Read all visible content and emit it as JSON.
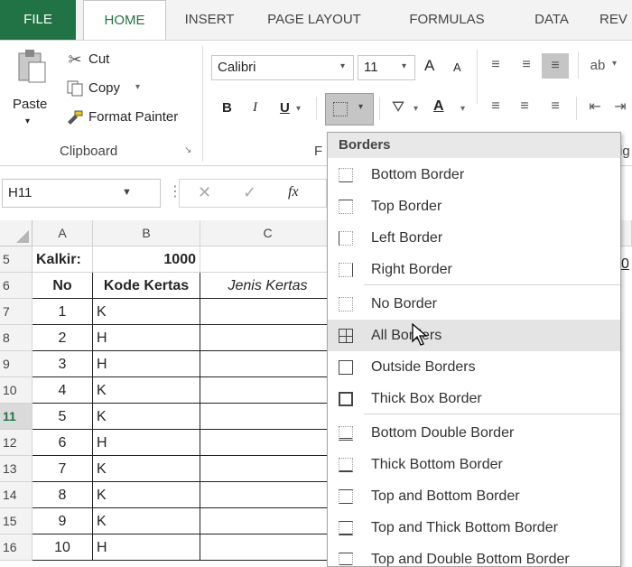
{
  "tabs": [
    {
      "label": "FILE"
    },
    {
      "label": "HOME"
    },
    {
      "label": "INSERT"
    },
    {
      "label": "PAGE LAYOUT"
    },
    {
      "label": "FORMULAS"
    },
    {
      "label": "DATA"
    },
    {
      "label": "REV"
    }
  ],
  "clipboard": {
    "paste": "Paste",
    "cut": "Cut",
    "copy": "Copy",
    "format_painter": "Format Painter",
    "group_label": "Clipboard"
  },
  "font": {
    "name": "Calibri",
    "size": "11",
    "group_label_partial": "F",
    "bold": "B",
    "italic": "I",
    "underline": "U",
    "font_color": "A",
    "grow": "A",
    "shrink": "A"
  },
  "alignment_partial": "ig",
  "namebox": "H11",
  "fx": "fx",
  "columns": [
    {
      "label": "A"
    },
    {
      "label": "B"
    },
    {
      "label": "C"
    }
  ],
  "rows": [
    {
      "num": "5",
      "a": "Kalkir:",
      "b": "1000",
      "c": ""
    },
    {
      "num": "6",
      "a": "No",
      "b": "Kode Kertas",
      "c": "Jenis Kertas"
    },
    {
      "num": "7",
      "a": "1",
      "b": "K",
      "c": ""
    },
    {
      "num": "8",
      "a": "2",
      "b": "H",
      "c": ""
    },
    {
      "num": "9",
      "a": "3",
      "b": "H",
      "c": ""
    },
    {
      "num": "10",
      "a": "4",
      "b": "K",
      "c": ""
    },
    {
      "num": "11",
      "a": "5",
      "b": "K",
      "c": ""
    },
    {
      "num": "12",
      "a": "6",
      "b": "H",
      "c": ""
    },
    {
      "num": "13",
      "a": "7",
      "b": "K",
      "c": ""
    },
    {
      "num": "14",
      "a": "8",
      "b": "K",
      "c": ""
    },
    {
      "num": "15",
      "a": "9",
      "b": "K",
      "c": ""
    },
    {
      "num": "16",
      "a": "10",
      "b": "H",
      "c": ""
    }
  ],
  "right_edge_partial": "0",
  "menu": {
    "title": "Borders",
    "items": [
      {
        "label": "Bottom Border"
      },
      {
        "label": "Top Border"
      },
      {
        "label": "Left Border"
      },
      {
        "label": "Right Border"
      },
      {
        "label": "No Border"
      },
      {
        "label": "All Borders"
      },
      {
        "label": "Outside Borders"
      },
      {
        "label": "Thick Box Border"
      },
      {
        "label": "Bottom Double Border"
      },
      {
        "label": "Thick Bottom Border"
      },
      {
        "label": "Top and Bottom Border"
      },
      {
        "label": "Top and Thick Bottom Border"
      },
      {
        "label": "Top and Double Bottom Border"
      }
    ]
  },
  "colors": {
    "accent": "#217346",
    "highlight": "#e4e4e4"
  }
}
